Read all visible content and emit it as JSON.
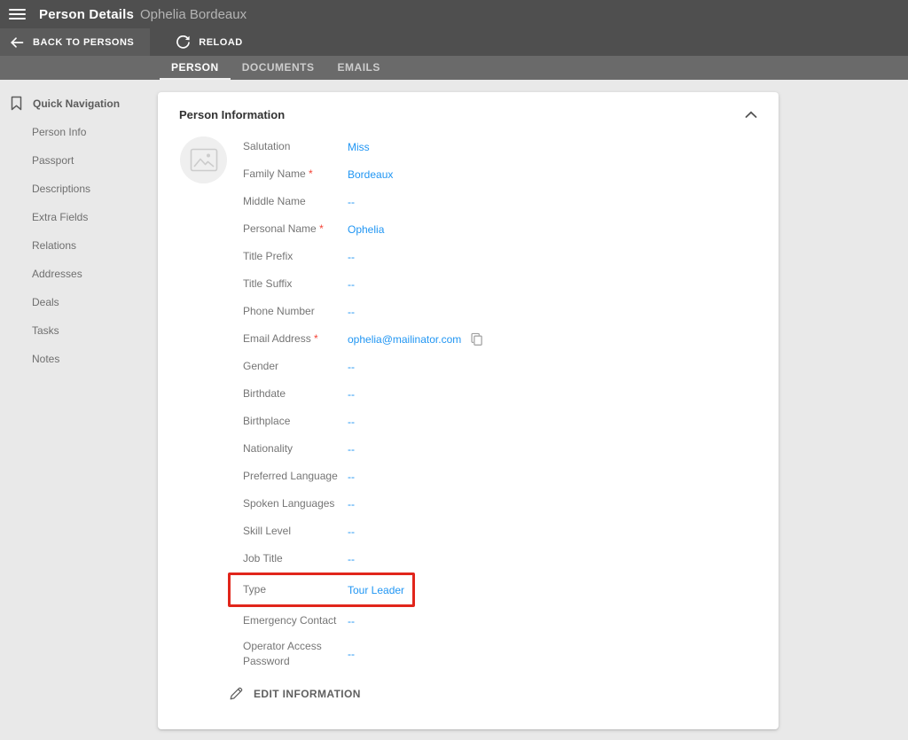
{
  "header": {
    "title": "Person Details",
    "subtitle": "Ophelia Bordeaux",
    "back_label": "BACK TO PERSONS",
    "reload_label": "RELOAD"
  },
  "tabs": [
    {
      "label": "PERSON",
      "active": true
    },
    {
      "label": "DOCUMENTS",
      "active": false
    },
    {
      "label": "EMAILS",
      "active": false
    }
  ],
  "sidebar": {
    "title": "Quick Navigation",
    "items": [
      "Person Info",
      "Passport",
      "Descriptions",
      "Extra Fields",
      "Relations",
      "Addresses",
      "Deals",
      "Tasks",
      "Notes"
    ]
  },
  "card": {
    "title": "Person Information",
    "fields": [
      {
        "label": "Salutation",
        "value": "Miss"
      },
      {
        "label": "Family Name",
        "value": "Bordeaux",
        "required": true
      },
      {
        "label": "Middle Name",
        "value": "--"
      },
      {
        "label": "Personal Name",
        "value": "Ophelia",
        "required": true
      },
      {
        "label": "Title Prefix",
        "value": "--"
      },
      {
        "label": "Title Suffix",
        "value": "--"
      },
      {
        "label": "Phone Number",
        "value": "--"
      },
      {
        "label": "Email Address",
        "value": "ophelia@mailinator.com",
        "required": true,
        "copy": true
      },
      {
        "label": "Gender",
        "value": "--"
      },
      {
        "label": "Birthdate",
        "value": "--"
      },
      {
        "label": "Birthplace",
        "value": "--"
      },
      {
        "label": "Nationality",
        "value": "--"
      },
      {
        "label": "Preferred Language",
        "value": "--"
      },
      {
        "label": "Spoken Languages",
        "value": "--"
      },
      {
        "label": "Skill Level",
        "value": "--"
      },
      {
        "label": "Job Title",
        "value": "--"
      },
      {
        "label": "Type",
        "value": "Tour Leader",
        "highlighted": true
      },
      {
        "label": "Emergency Contact",
        "value": "--"
      },
      {
        "label": "Operator Access Password",
        "value": "--",
        "tall": true
      }
    ],
    "edit_button": "EDIT INFORMATION"
  },
  "icons": {
    "hamburger": "menu-icon",
    "back": "back-arrow-icon",
    "reload": "reload-icon",
    "bookmark": "bookmark-icon",
    "image_placeholder": "image-placeholder-icon",
    "copy": "copy-icon",
    "collapse": "chevron-up-icon",
    "edit": "pencil-icon"
  },
  "colors": {
    "header_gray": "#4f4f4f",
    "tabbar_gray": "#6a6a6a",
    "page_bg": "#e9e9e9",
    "accent_blue": "#2196f3",
    "required_red": "#f44336",
    "highlight_red": "#e1251b"
  }
}
